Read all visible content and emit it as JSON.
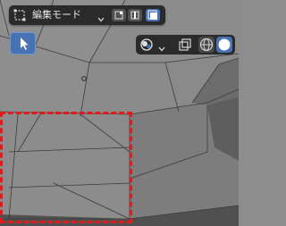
{
  "header": {
    "mode_label": "編集モード",
    "mode_icon": "edit-mode-icon",
    "select_modes": [
      "vertex-select-icon",
      "edge-select-icon",
      "face-select-icon"
    ],
    "active_select_mode": "face"
  },
  "toolbar": {
    "active_tool_icon": "select-cursor-icon"
  },
  "overlays": {
    "icons": [
      "overlay-icon",
      "xray-icon",
      "wireframe-shading-icon",
      "solid-shading-icon"
    ]
  },
  "colors": {
    "accent": "#4772b3",
    "highlight": "#e11b1b",
    "header_bg": "#2a2a2a"
  }
}
